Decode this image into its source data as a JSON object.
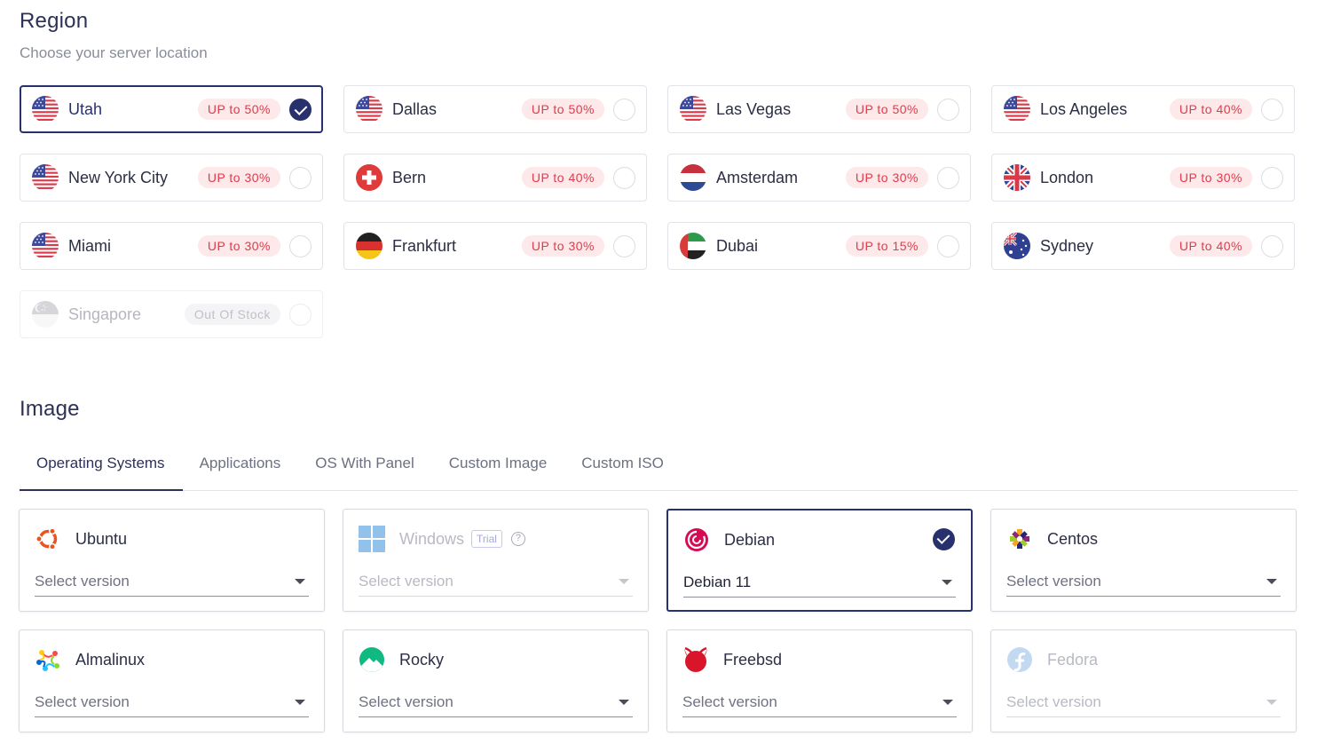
{
  "region": {
    "title": "Region",
    "subtitle": "Choose your server location",
    "locations": [
      {
        "name": "Utah",
        "badge": "UP to 50%",
        "flag": "us",
        "selected": true,
        "disabled": false
      },
      {
        "name": "Dallas",
        "badge": "UP to 50%",
        "flag": "us",
        "selected": false,
        "disabled": false
      },
      {
        "name": "Las Vegas",
        "badge": "UP to 50%",
        "flag": "us",
        "selected": false,
        "disabled": false
      },
      {
        "name": "Los Angeles",
        "badge": "UP to 40%",
        "flag": "us",
        "selected": false,
        "disabled": false
      },
      {
        "name": "New York City",
        "badge": "UP to 30%",
        "flag": "us",
        "selected": false,
        "disabled": false
      },
      {
        "name": "Bern",
        "badge": "UP to 40%",
        "flag": "ch",
        "selected": false,
        "disabled": false
      },
      {
        "name": "Amsterdam",
        "badge": "UP to 30%",
        "flag": "nl",
        "selected": false,
        "disabled": false
      },
      {
        "name": "London",
        "badge": "UP to 30%",
        "flag": "gb",
        "selected": false,
        "disabled": false
      },
      {
        "name": "Miami",
        "badge": "UP to 30%",
        "flag": "us",
        "selected": false,
        "disabled": false
      },
      {
        "name": "Frankfurt",
        "badge": "UP to 30%",
        "flag": "de",
        "selected": false,
        "disabled": false
      },
      {
        "name": "Dubai",
        "badge": "UP to 15%",
        "flag": "ae",
        "selected": false,
        "disabled": false
      },
      {
        "name": "Sydney",
        "badge": "UP to 40%",
        "flag": "au",
        "selected": false,
        "disabled": false
      },
      {
        "name": "Singapore",
        "badge": "Out Of Stock",
        "flag": "sg",
        "selected": false,
        "disabled": true
      }
    ]
  },
  "image": {
    "title": "Image",
    "tabs": [
      {
        "label": "Operating Systems",
        "active": true
      },
      {
        "label": "Applications",
        "active": false
      },
      {
        "label": "OS With Panel",
        "active": false
      },
      {
        "label": "Custom Image",
        "active": false
      },
      {
        "label": "Custom ISO",
        "active": false
      }
    ],
    "systems": [
      {
        "name": "Ubuntu",
        "logo": "ubuntu-icon",
        "value": "",
        "placeholder": "Select version",
        "selected": false,
        "disabled": false
      },
      {
        "name": "Windows",
        "logo": "windows-icon",
        "value": "",
        "placeholder": "Select version",
        "selected": false,
        "disabled": true,
        "tag": "Trial",
        "help": "?"
      },
      {
        "name": "Debian",
        "logo": "debian-icon",
        "value": "Debian 11",
        "placeholder": "Select version",
        "selected": true,
        "disabled": false
      },
      {
        "name": "Centos",
        "logo": "centos-icon",
        "value": "",
        "placeholder": "Select version",
        "selected": false,
        "disabled": false
      },
      {
        "name": "Almalinux",
        "logo": "almalinux-icon",
        "value": "",
        "placeholder": "Select version",
        "selected": false,
        "disabled": false
      },
      {
        "name": "Rocky",
        "logo": "rocky-icon",
        "value": "",
        "placeholder": "Select version",
        "selected": false,
        "disabled": false
      },
      {
        "name": "Freebsd",
        "logo": "freebsd-icon",
        "value": "",
        "placeholder": "Select version",
        "selected": false,
        "disabled": false
      },
      {
        "name": "Fedora",
        "logo": "fedora-icon",
        "value": "",
        "placeholder": "Select version",
        "selected": false,
        "disabled": true
      }
    ]
  },
  "colors": {
    "accent": "#28306e",
    "badge_bg": "#fde8ea",
    "badge_text": "#e23a4a"
  }
}
